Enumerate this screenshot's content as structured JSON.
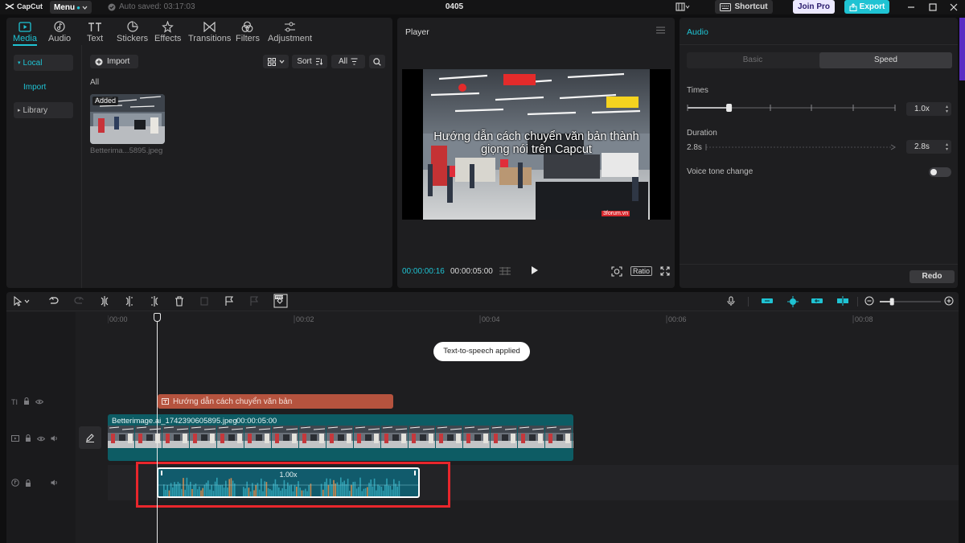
{
  "app": {
    "logo_text": "CapCut",
    "menu_label": "Menu",
    "autosave_text": "Auto saved: 03:17:03",
    "project_title": "0405",
    "shortcut_label": "Shortcut",
    "joinpro_label": "Join Pro",
    "export_label": "Export"
  },
  "toolbar": {
    "tabs": [
      {
        "label": "Media",
        "icon": "media-icon",
        "active": true
      },
      {
        "label": "Audio",
        "icon": "audio-icon"
      },
      {
        "label": "Text",
        "icon": "text-icon"
      },
      {
        "label": "Stickers",
        "icon": "sticker-icon"
      },
      {
        "label": "Effects",
        "icon": "effects-icon"
      },
      {
        "label": "Transitions",
        "icon": "transitions-icon"
      },
      {
        "label": "Filters",
        "icon": "filters-icon"
      },
      {
        "label": "Adjustment",
        "icon": "adjustment-icon"
      }
    ]
  },
  "media": {
    "sidebar": {
      "local": "Local",
      "import": "Import",
      "library": "Library"
    },
    "import_label": "Import",
    "sort_label": "Sort",
    "filter_label": "All",
    "all_heading": "All",
    "added_badge": "Added",
    "filename": "Betterima...5895.jpeg"
  },
  "player": {
    "title": "Player",
    "caption": "Hướng dẫn cách chuyển văn bản thành giọng nói trên Capcut",
    "watermark": "3forum.vn",
    "time_current": "00:00:00:16",
    "time_total": "00:00:05:00",
    "ratio_label": "Ratio"
  },
  "audio_panel": {
    "title": "Audio",
    "tab_basic": "Basic",
    "tab_speed": "Speed",
    "times_label": "Times",
    "times_value": "1.0x",
    "times_slider_fraction": 0.2,
    "duration_label": "Duration",
    "duration_start": "2.8s",
    "duration_value": "2.8s",
    "voice_tone_label": "Voice tone change",
    "voice_tone_on": false,
    "redo_label": "Redo"
  },
  "timeline": {
    "ruler": [
      "00:00",
      "00:02",
      "00:04",
      "00:06",
      "00:08"
    ],
    "toast": "Text-to-speech applied",
    "text_clip_label": "Hướng dẫn cách chuyển văn bản",
    "video_clip_name": "Betterimage.ai_1742390605895.jpeg",
    "video_clip_duration": "00:00:05:00",
    "audio_speed_label": "1.00x",
    "zoom_fraction": 0.2
  },
  "colors": {
    "accent": "#1fc3d3",
    "text_clip": "#b5533e",
    "video_clip": "#0d5c64",
    "audio_clip": "#115b6c",
    "highlight": "#e8262c"
  }
}
